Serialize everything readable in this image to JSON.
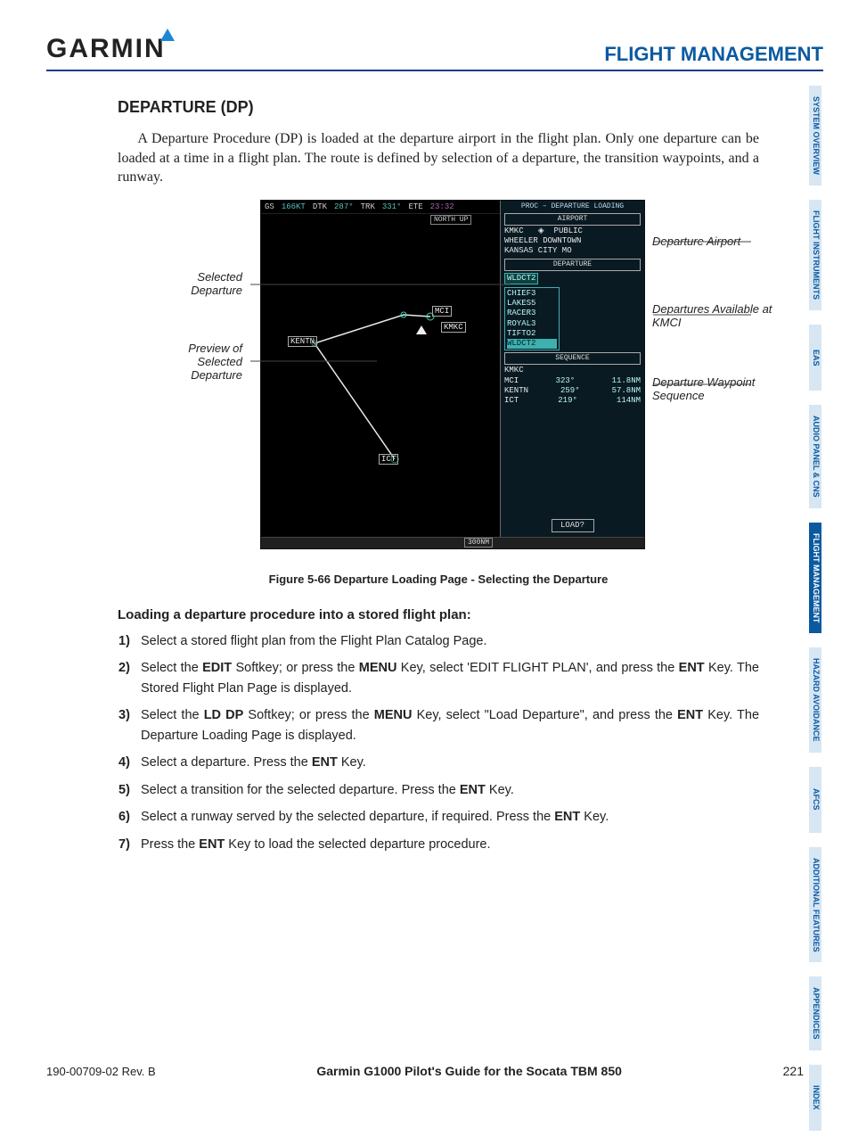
{
  "header": {
    "brand": "GARMIN",
    "section": "FLIGHT MANAGEMENT"
  },
  "tabs": [
    {
      "label": "SYSTEM OVERVIEW",
      "active": false
    },
    {
      "label": "FLIGHT INSTRUMENTS",
      "active": false
    },
    {
      "label": "EAS",
      "active": false
    },
    {
      "label": "AUDIO PANEL & CNS",
      "active": false
    },
    {
      "label": "FLIGHT MANAGEMENT",
      "active": true
    },
    {
      "label": "HAZARD AVOIDANCE",
      "active": false
    },
    {
      "label": "AFCS",
      "active": false
    },
    {
      "label": "ADDITIONAL FEATURES",
      "active": false
    },
    {
      "label": "APPENDICES",
      "active": false
    },
    {
      "label": "INDEX",
      "active": false
    }
  ],
  "heading": "DEPARTURE (DP)",
  "intro": "A Departure Procedure (DP) is loaded at the departure airport in the flight plan. Only one departure can be loaded at a time in a flight plan. The route is defined by selection of a departure, the transition waypoints, and a runway.",
  "figure": {
    "topbar": {
      "gs_label": "GS",
      "gs": "166KT",
      "dtk_label": "DTK",
      "dtk": "287°",
      "trk_label": "TRK",
      "trk": "331°",
      "ete_label": "ETE",
      "ete": "23:32",
      "proc": "PROC – DEPARTURE LOADING"
    },
    "north": "NORTH UP",
    "map_waypoints": {
      "mci": "MCI",
      "kmkc": "KMKC",
      "kentn": "KENTN",
      "ict": "ICT"
    },
    "airport_box_hdr": "AIRPORT",
    "airport_ident": "KMKC",
    "airport_type": "PUBLIC",
    "airport_name": "WHEELER DOWNTOWN",
    "airport_city": "KANSAS CITY MO",
    "departure_box_hdr": "DEPARTURE",
    "selected_departure": "WLDCT2",
    "departures": [
      "CHIEF3",
      "LAKES5",
      "RACER3",
      "ROYAL3",
      "TIFTO2",
      "WLDCT2"
    ],
    "sequence_box_hdr": "SEQUENCE",
    "sequence": [
      {
        "wp": "KMKC",
        "brg": "",
        "dist": ""
      },
      {
        "wp": "MCI",
        "brg": "323°",
        "dist": "11.8NM"
      },
      {
        "wp": "KENTN",
        "brg": "259°",
        "dist": "57.8NM"
      },
      {
        "wp": "ICT",
        "brg": "219°",
        "dist": "114NM"
      }
    ],
    "load_btn": "LOAD?",
    "scale": "300NM",
    "callouts": {
      "left1": "Selected Departure",
      "left2": "Preview of Selected Departure",
      "right1": "Departure Airport",
      "right2": "Departures Available at KMCI",
      "right3": "Departure Waypoint Sequence"
    },
    "caption": "Figure 5-66  Departure Loading Page - Selecting the Departure"
  },
  "procedure_heading": "Loading a departure procedure into a stored flight plan:",
  "steps": {
    "s1": "Select a stored flight plan from the Flight Plan Catalog Page.",
    "s2a": "Select the ",
    "s2b": " Softkey; or press the ",
    "s2c": " Key, select 'EDIT FLIGHT PLAN', and press the ",
    "s2d": " Key.  The Stored Flight Plan Page is displayed.",
    "s3a": "Select the ",
    "s3b": " Softkey; or press the ",
    "s3c": " Key, select \"Load Departure\", and press the ",
    "s3d": " Key.  The Departure Loading Page is displayed.",
    "s4a": "Select a departure.  Press the ",
    "s4b": " Key.",
    "s5a": "Select a transition for the selected departure.  Press the ",
    "s5b": " Key.",
    "s6a": "Select a runway served by the selected departure, if required.  Press the ",
    "s6b": " Key.",
    "s7a": "Press the ",
    "s7b": " Key to load the selected departure procedure.",
    "k_edit": "EDIT",
    "k_menu": "MENU",
    "k_ent": "ENT",
    "k_lddp": "LD DP"
  },
  "footer": {
    "rev": "190-00709-02  Rev. B",
    "guide": "Garmin G1000 Pilot's Guide for the Socata TBM 850",
    "page": "221"
  }
}
